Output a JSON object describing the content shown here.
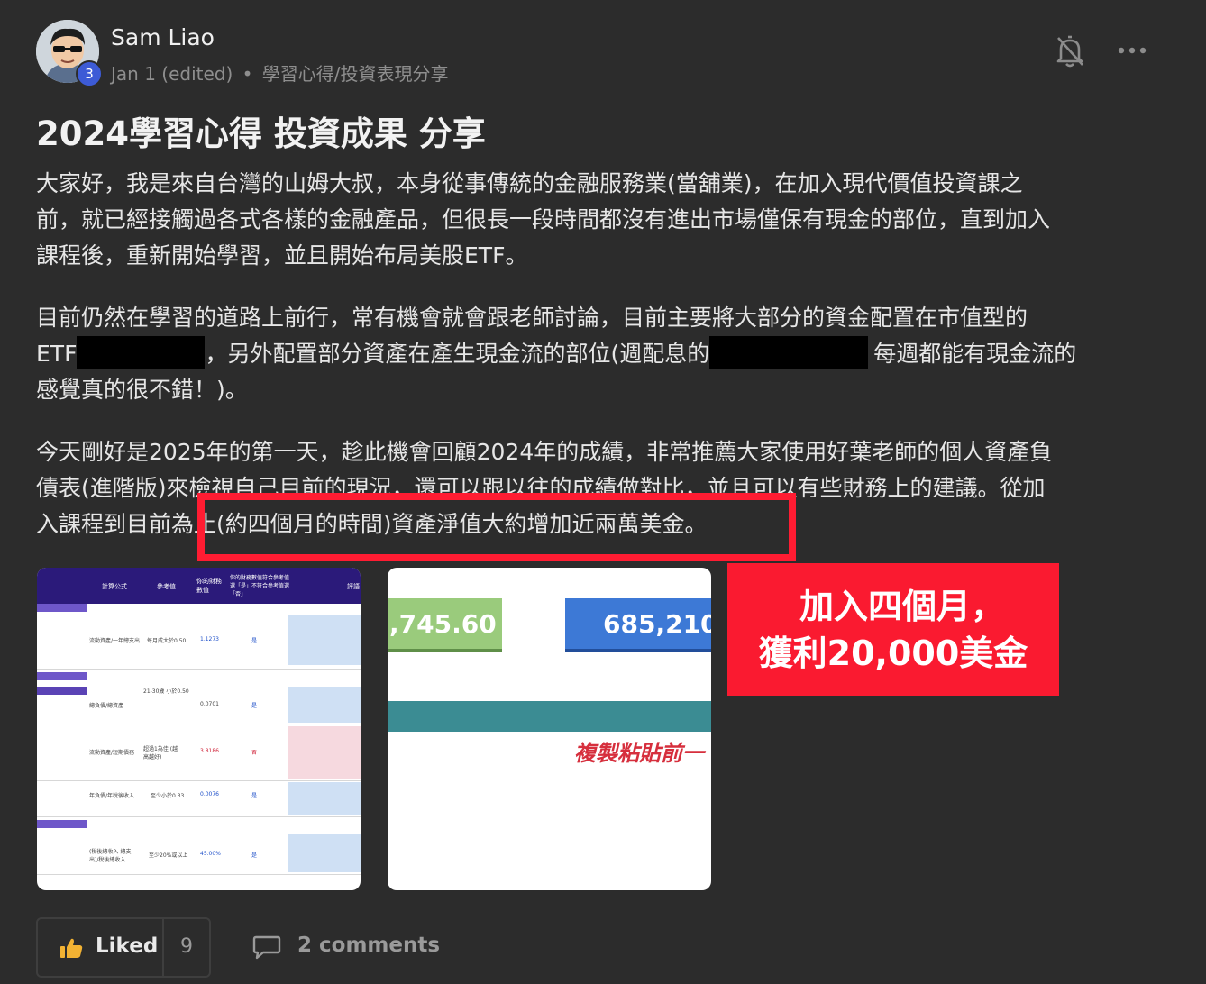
{
  "author": {
    "name": "Sam Liao",
    "level": "3",
    "date": "Jan 1 (edited)",
    "separator": "•",
    "category": "學習心得/投資表現分享"
  },
  "post": {
    "title": "2024學習心得 投資成果 分享",
    "paragraph1": [
      "大家好，我是來自台灣的山姆大叔，本身從事傳統的金融服務業(當舖業)，在加入現代價值投資課之",
      "前，就已經接觸過各式各樣的金融產品，但很長一段時間都沒有進出市場僅保有現金的部位，直到加入",
      "課程後，重新開始學習，並且開始布局美股ETF。"
    ],
    "paragraph2": {
      "line1": "目前仍然在學習的道路上前行，常有機會就會跟老師討論，目前主要將大部分的資金配置在市值型的",
      "line2_a": "ETF",
      "line2_b": "，另外配置部分資產在產生現金流的部位(週配息的",
      "line2_c": "每週都能有現金流的",
      "line3": "感覺真的很不錯！)。"
    },
    "paragraph3": [
      "今天剛好是2025年的第一天，趁此機會回顧2024年的成績，非常推薦大家使用好葉老師的個人資產負",
      "債表(進階版)來檢視自己目前的現況，還可以跟以往的成績做對比，並且可以有些財務上的建議。從加",
      "入課程到目前為止(約四個月的時間)資產淨值大約增加近兩萬美金。"
    ]
  },
  "callout": {
    "line1": "加入四個月，",
    "line2": "獲利20,000美金"
  },
  "images": {
    "table": {
      "headers": [
        "計算公式",
        "參考值",
        "你的財務數值",
        "你的財務數值符合參考值選「是」不符合參考值選「否」",
        "評語"
      ],
      "rows": [
        {
          "formula": "流動資產/一年總支出",
          "ref": "每月成大於0.50",
          "value": "1.1273",
          "ok": "是"
        },
        {
          "formula": "總負債/總資產",
          "ref": "21-30歲 小於0.50",
          "value": "0.0701",
          "ok": "是"
        },
        {
          "formula": "流動資產/短期債務",
          "ref": "超過1為佳 (越高越好)",
          "value": "3.8186",
          "ok": "否"
        },
        {
          "formula": "年負債/年稅後收入",
          "ref": "至少小於0.33",
          "value": "0.0076",
          "ok": "是"
        },
        {
          "formula": "(稅後總收入-總支出)/稅後總收入",
          "ref": "至少20%或以上",
          "value": "45.00%",
          "ok": "是"
        }
      ]
    },
    "summary": {
      "left_value": ",745.60",
      "right_value": "685,210.",
      "note": "複製粘貼前一"
    }
  },
  "footer": {
    "like_label": "Liked",
    "like_count": "9",
    "comments_label": "2 comments"
  }
}
